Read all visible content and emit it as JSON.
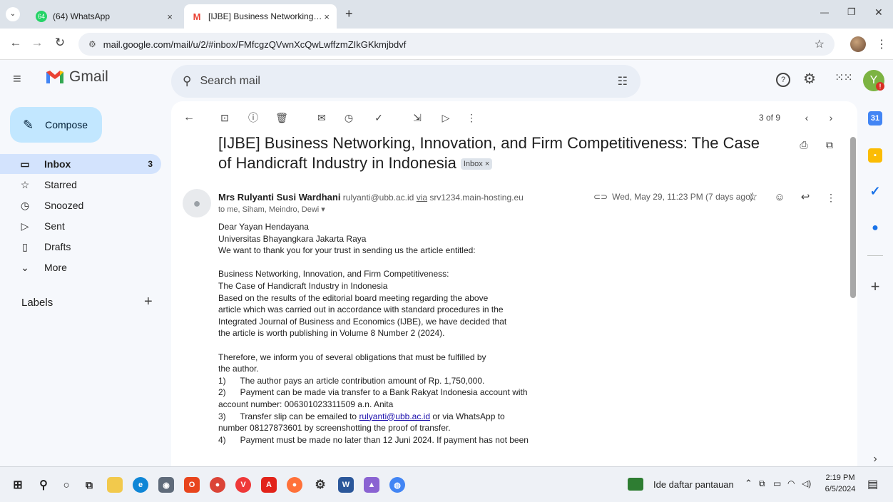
{
  "browser": {
    "tabs": [
      {
        "label": "(64) WhatsApp",
        "badge": "64",
        "close": "×"
      },
      {
        "label": "[IJBE] Business Networking, Inno",
        "close": "×"
      }
    ],
    "new_tab": "+",
    "window_controls": {
      "minimize": "—",
      "restore": "❐",
      "close": "✕"
    },
    "url": "mail.google.com/mail/u/2/#inbox/FMfcgzQVwnXcQwLwffzmZIkGKkmjbdvf"
  },
  "gmail": {
    "logo_text": "Gmail",
    "search_placeholder": "Search mail",
    "account_initial": "Y",
    "compose_label": "Compose",
    "nav": [
      {
        "label": "Inbox",
        "count": "3",
        "icon": "inbox-icon"
      },
      {
        "label": "Starred",
        "icon": "star-icon"
      },
      {
        "label": "Snoozed",
        "icon": "clock-icon"
      },
      {
        "label": "Sent",
        "icon": "send-icon"
      },
      {
        "label": "Drafts",
        "icon": "draft-icon"
      },
      {
        "label": "More",
        "icon": "chevron-down-icon"
      }
    ],
    "labels_title": "Labels",
    "labels_add": "+"
  },
  "message": {
    "pager": "3 of 9",
    "subject": "[IJBE] Business Networking, Innovation, and Firm Competitiveness: The Case of Handicraft Industry in Indonesia",
    "inbox_chip": "Inbox ×",
    "sender_name": "Mrs Rulyanti Susi Wardhani",
    "sender_email": "rulyanti@ubb.ac.id",
    "via_label": "via",
    "via_domain": "srv1234.main-hosting.eu",
    "to_line": "to me, Siham, Meindro, Dewi ▾",
    "date": "Wed, May 29, 11:23 PM (7 days ago)",
    "body_lines": [
      "Dear Yayan Hendayana",
      "Universitas Bhayangkara Jakarta Raya",
      "We want to thank you for your trust in sending us the article entitled:",
      "",
      "Business Networking, Innovation, and Firm Competitiveness:",
      "The Case of Handicraft Industry in Indonesia",
      "Based on the results of the editorial board meeting regarding the above",
      "article which was carried out in accordance with standard procedures in the",
      "Integrated Journal of Business and Economics (IJBE), we have decided that",
      "the article is worth publishing in Volume 8 Number 2 (2024).",
      "",
      "Therefore, we inform you of several obligations that must be fulfilled by",
      "the author.",
      "1)      The author pays an article contribution amount of Rp. 1,750,000.",
      "2)      Payment can be made via transfer to a Bank Rakyat Indonesia account with",
      "account number: 006301023311509 a.n. Anita"
    ],
    "line_3_pre": "3)      Transfer slip can be emailed to ",
    "line_3_link": "rulyanti@ubb.ac.id",
    "line_3_post": " or via WhatsApp to",
    "body_tail": [
      "number 08127873601 by screenshotting the proof of transfer.",
      "4)      Payment must be made no later than 12 Juni 2024. If payment has not been"
    ]
  },
  "taskbar": {
    "notification": "Ide daftar pantauan",
    "time": "2:19 PM",
    "date": "6/5/2024"
  },
  "colors": {
    "gmail_red": "#ea4335",
    "compose_bg": "#c2e7ff",
    "active_nav": "#d3e3fd"
  }
}
